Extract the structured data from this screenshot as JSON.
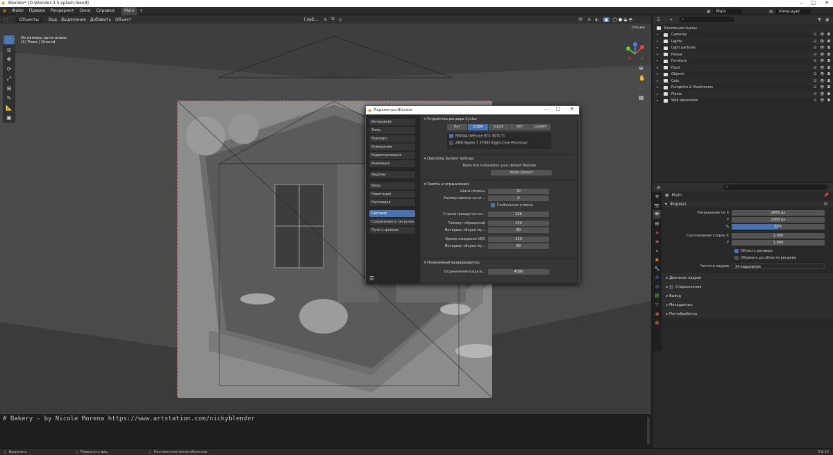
{
  "window": {
    "title": "Blender* [D:\\blender-3.5-splash.blend]"
  },
  "menu": [
    "Файл",
    "Правка",
    "Рендеринг",
    "Окно",
    "Справка"
  ],
  "workspace_tab": "Main",
  "add_tab": "+",
  "viewport_header": {
    "mode": "Объекты",
    "items": [
      "Вид",
      "Выделение",
      "Добавить",
      "Объект"
    ],
    "orientation": "Глоб...",
    "options": "Опции"
  },
  "viewport_info": {
    "line1": "Из камеры ортогональ",
    "line2": "(1) Trees | Ground"
  },
  "scene": {
    "label": "Main",
    "view_layer": "ViewLayer"
  },
  "outliner": {
    "header": "Коллекция сцены",
    "items": [
      {
        "name": "Cameras"
      },
      {
        "name": "Lights"
      },
      {
        "name": "Light particles"
      },
      {
        "name": "House"
      },
      {
        "name": "Furniture"
      },
      {
        "name": "Food"
      },
      {
        "name": "Objects"
      },
      {
        "name": "Cats"
      },
      {
        "name": "Pumpkins & Mushrooms"
      },
      {
        "name": "Plants"
      },
      {
        "name": "Wall decoration"
      }
    ]
  },
  "properties": {
    "object": "Main",
    "section": "Формат",
    "res_x_label": "Разрешение по X",
    "res_x": "2655 px",
    "res_y_label": "Y",
    "res_y": "2500 px",
    "pct_label": "%",
    "pct": "50%",
    "pct_fraction": 0.5,
    "aspect_x_label": "Соотношение сторон X",
    "aspect_x": "1.000",
    "aspect_y_label": "Y",
    "aspect_y": "1.000",
    "render_region": "Область рендера",
    "crop_region": "Обрезать до области рендера",
    "fps_label": "Частота кадров",
    "fps": "24 кадров/сек",
    "panels": [
      "Диапазон кадров",
      "Стереоскопия",
      "Вывод",
      "Метаданные",
      "Постобработка"
    ]
  },
  "prefs": {
    "title": "Параметры Blender",
    "nav": [
      "Интерфейс",
      "Темы",
      "Вьюпорт",
      "Освещение",
      "Редактирование",
      "Анимация",
      "Аддоны",
      "Ввод",
      "Навигация",
      "Раскладка",
      "Система",
      "Сохранение и загрузка",
      "Пути к файлам"
    ],
    "active_nav": "Система",
    "cycles_title": "Устройства рендера Cycles",
    "cycles_tabs": [
      "Нет",
      "CUDA",
      "OptiX",
      "HIP",
      "oneAPI"
    ],
    "device1": "NVIDIA GeForce RTX 3070 Ti",
    "device2": "AMD Ryzen 7 2700X Eight-Core Processor",
    "os_title": "Operating System Settings",
    "os_text": "Make this installation your default Blender",
    "make_default": "Make Default",
    "mem_title": "Память и ограничения",
    "undo_steps_label": "Шаги отмены",
    "undo_steps": "32",
    "undo_mem_label": "Размер памяти на от...",
    "undo_mem": "0",
    "global_undo": "Глобальная отмена",
    "scroll_label": "Строки прокрутки ко...",
    "scroll": "256",
    "timeout_label": "Таймаут обращений",
    "timeout": "120",
    "gc_label": "Интервал сборки му...",
    "gc": "60",
    "vbo_time_label": "Время ожидания VBO",
    "vbo_time": "120",
    "vbo_gc_label": "Интервал сборки му...",
    "vbo_gc": "60",
    "vse_title": "Нелинейный видеоредактор",
    "cache_label": "Ограничение кэша в...",
    "cache": "4096"
  },
  "console": {
    "text": "# Bakery - by Nicole Morena https://www.artstation.com/nickyblender"
  },
  "status": {
    "select": "Выделить",
    "rotate": "Повернуть вид",
    "context": "Контекстное меню объектов",
    "version": "3.6.14"
  }
}
